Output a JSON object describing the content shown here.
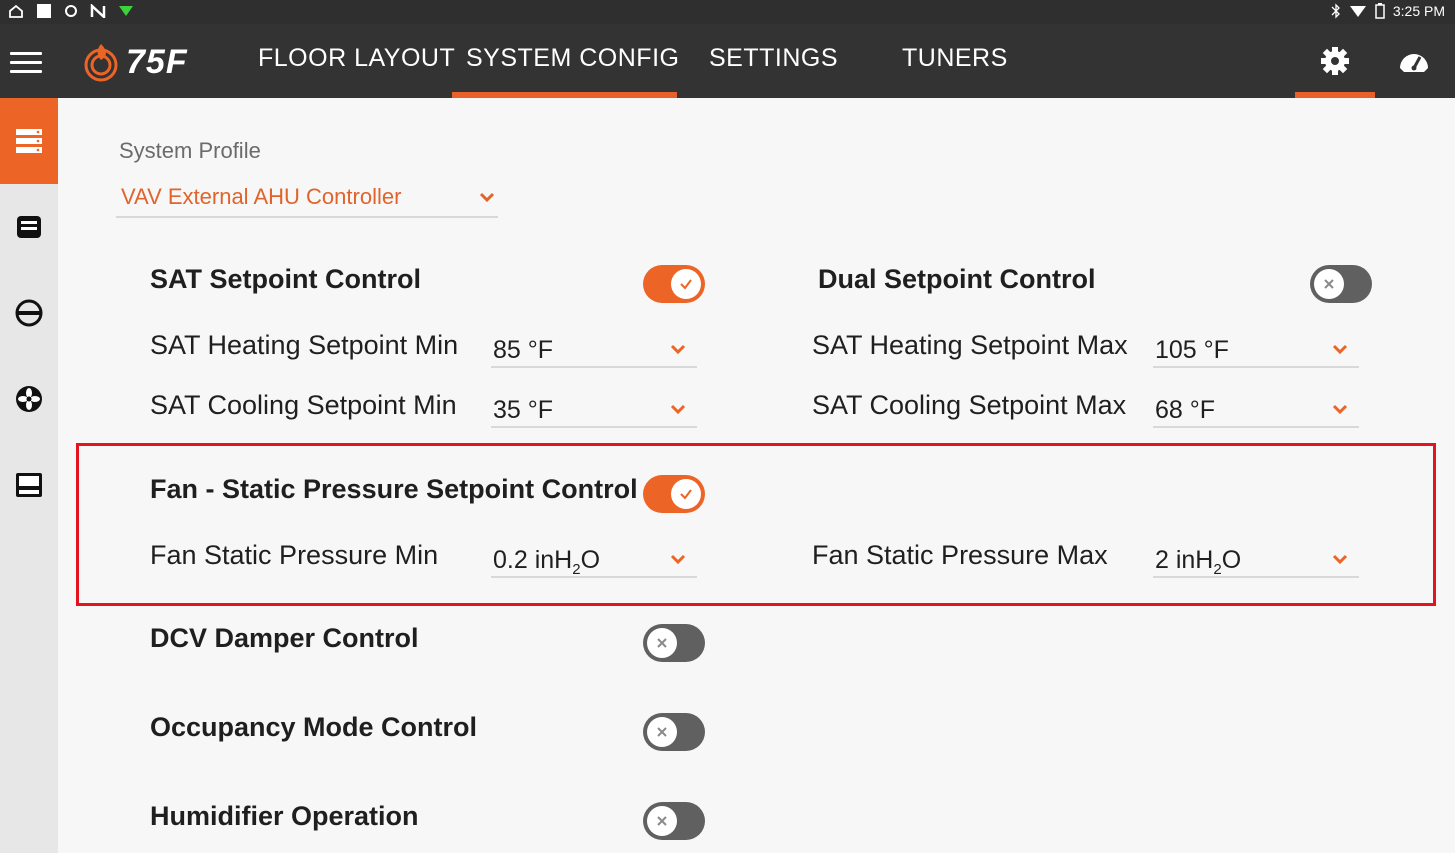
{
  "status_bar": {
    "time": "3:25 PM",
    "left_icons": [
      "home-outline-icon",
      "square-icon",
      "sync-icon",
      "n-icon",
      "wifi-green-icon"
    ],
    "right_icons": [
      "bluetooth-icon",
      "wifi-icon",
      "battery-icon"
    ]
  },
  "app_bar": {
    "logo_text": "75F",
    "tabs": [
      {
        "label": "FLOOR LAYOUT",
        "active": false
      },
      {
        "label": "SYSTEM CONFIG",
        "active": true
      },
      {
        "label": "SETTINGS",
        "active": false
      },
      {
        "label": "TUNERS",
        "active": false
      }
    ],
    "right_icons": [
      {
        "name": "settings-gear-icon",
        "active": true
      },
      {
        "name": "dashboard-gauge-icon",
        "active": false
      }
    ]
  },
  "rail": {
    "items": [
      {
        "name": "system-profile-icon",
        "active": true
      },
      {
        "name": "modules-icon",
        "active": false
      },
      {
        "name": "no-entry-icon",
        "active": false
      },
      {
        "name": "fan-icon",
        "active": false
      },
      {
        "name": "display-icon",
        "active": false
      }
    ]
  },
  "profile": {
    "label": "System Profile",
    "value": "VAV External AHU Controller"
  },
  "sat": {
    "title": "SAT Setpoint Control",
    "enabled": true,
    "heating_min": {
      "label": "SAT Heating Setpoint Min",
      "value": "85 °F"
    },
    "cooling_min": {
      "label": "SAT Cooling Setpoint Min",
      "value": "35 °F"
    },
    "heating_max": {
      "label": "SAT Heating Setpoint Max",
      "value": "105 °F"
    },
    "cooling_max": {
      "label": "SAT Cooling Setpoint Max",
      "value": "68 °F"
    }
  },
  "dual": {
    "title": "Dual Setpoint Control",
    "enabled": false
  },
  "fan": {
    "title": "Fan - Static Pressure Setpoint Control",
    "enabled": true,
    "min": {
      "label": "Fan Static Pressure Min",
      "value_num": "0.2 inH",
      "value_sub": "2",
      "value_end": "O"
    },
    "max": {
      "label": "Fan Static Pressure Max",
      "value_num": "2 inH",
      "value_sub": "2",
      "value_end": "O"
    }
  },
  "dcv": {
    "title": "DCV Damper Control",
    "enabled": false
  },
  "occupancy": {
    "title": "Occupancy Mode Control",
    "enabled": false
  },
  "humidifier": {
    "title": "Humidifier Operation",
    "enabled": false
  },
  "colors": {
    "accent": "#ec6426",
    "appbar": "#333333",
    "highlight_box": "#e3141f",
    "toggle_off": "#606060"
  }
}
